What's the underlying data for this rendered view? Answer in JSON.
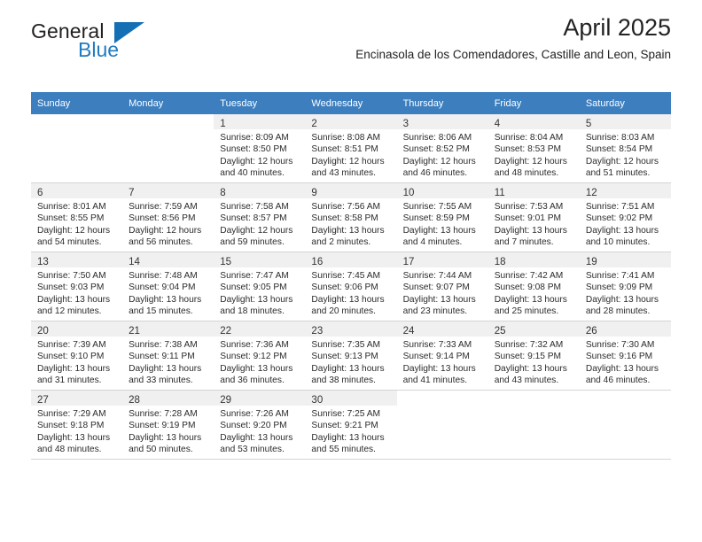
{
  "brand": {
    "name_part1": "General",
    "name_part2": "Blue",
    "triangle_icon": "logo-triangle-icon",
    "accent_color": "#156fb5"
  },
  "header": {
    "title": "April 2025",
    "subtitle": "Encinasola de los Comendadores, Castille and Leon, Spain"
  },
  "calendar": {
    "header_bg": "#3c7ebe",
    "daynum_bg": "#f0f0f0",
    "weekday_headers": [
      "Sunday",
      "Monday",
      "Tuesday",
      "Wednesday",
      "Thursday",
      "Friday",
      "Saturday"
    ],
    "weeks": [
      [
        {
          "day": "",
          "sunrise": "",
          "sunset": "",
          "daylight_line1": "",
          "daylight_line2": ""
        },
        {
          "day": "",
          "sunrise": "",
          "sunset": "",
          "daylight_line1": "",
          "daylight_line2": ""
        },
        {
          "day": "1",
          "sunrise": "Sunrise: 8:09 AM",
          "sunset": "Sunset: 8:50 PM",
          "daylight_line1": "Daylight: 12 hours",
          "daylight_line2": "and 40 minutes."
        },
        {
          "day": "2",
          "sunrise": "Sunrise: 8:08 AM",
          "sunset": "Sunset: 8:51 PM",
          "daylight_line1": "Daylight: 12 hours",
          "daylight_line2": "and 43 minutes."
        },
        {
          "day": "3",
          "sunrise": "Sunrise: 8:06 AM",
          "sunset": "Sunset: 8:52 PM",
          "daylight_line1": "Daylight: 12 hours",
          "daylight_line2": "and 46 minutes."
        },
        {
          "day": "4",
          "sunrise": "Sunrise: 8:04 AM",
          "sunset": "Sunset: 8:53 PM",
          "daylight_line1": "Daylight: 12 hours",
          "daylight_line2": "and 48 minutes."
        },
        {
          "day": "5",
          "sunrise": "Sunrise: 8:03 AM",
          "sunset": "Sunset: 8:54 PM",
          "daylight_line1": "Daylight: 12 hours",
          "daylight_line2": "and 51 minutes."
        }
      ],
      [
        {
          "day": "6",
          "sunrise": "Sunrise: 8:01 AM",
          "sunset": "Sunset: 8:55 PM",
          "daylight_line1": "Daylight: 12 hours",
          "daylight_line2": "and 54 minutes."
        },
        {
          "day": "7",
          "sunrise": "Sunrise: 7:59 AM",
          "sunset": "Sunset: 8:56 PM",
          "daylight_line1": "Daylight: 12 hours",
          "daylight_line2": "and 56 minutes."
        },
        {
          "day": "8",
          "sunrise": "Sunrise: 7:58 AM",
          "sunset": "Sunset: 8:57 PM",
          "daylight_line1": "Daylight: 12 hours",
          "daylight_line2": "and 59 minutes."
        },
        {
          "day": "9",
          "sunrise": "Sunrise: 7:56 AM",
          "sunset": "Sunset: 8:58 PM",
          "daylight_line1": "Daylight: 13 hours",
          "daylight_line2": "and 2 minutes."
        },
        {
          "day": "10",
          "sunrise": "Sunrise: 7:55 AM",
          "sunset": "Sunset: 8:59 PM",
          "daylight_line1": "Daylight: 13 hours",
          "daylight_line2": "and 4 minutes."
        },
        {
          "day": "11",
          "sunrise": "Sunrise: 7:53 AM",
          "sunset": "Sunset: 9:01 PM",
          "daylight_line1": "Daylight: 13 hours",
          "daylight_line2": "and 7 minutes."
        },
        {
          "day": "12",
          "sunrise": "Sunrise: 7:51 AM",
          "sunset": "Sunset: 9:02 PM",
          "daylight_line1": "Daylight: 13 hours",
          "daylight_line2": "and 10 minutes."
        }
      ],
      [
        {
          "day": "13",
          "sunrise": "Sunrise: 7:50 AM",
          "sunset": "Sunset: 9:03 PM",
          "daylight_line1": "Daylight: 13 hours",
          "daylight_line2": "and 12 minutes."
        },
        {
          "day": "14",
          "sunrise": "Sunrise: 7:48 AM",
          "sunset": "Sunset: 9:04 PM",
          "daylight_line1": "Daylight: 13 hours",
          "daylight_line2": "and 15 minutes."
        },
        {
          "day": "15",
          "sunrise": "Sunrise: 7:47 AM",
          "sunset": "Sunset: 9:05 PM",
          "daylight_line1": "Daylight: 13 hours",
          "daylight_line2": "and 18 minutes."
        },
        {
          "day": "16",
          "sunrise": "Sunrise: 7:45 AM",
          "sunset": "Sunset: 9:06 PM",
          "daylight_line1": "Daylight: 13 hours",
          "daylight_line2": "and 20 minutes."
        },
        {
          "day": "17",
          "sunrise": "Sunrise: 7:44 AM",
          "sunset": "Sunset: 9:07 PM",
          "daylight_line1": "Daylight: 13 hours",
          "daylight_line2": "and 23 minutes."
        },
        {
          "day": "18",
          "sunrise": "Sunrise: 7:42 AM",
          "sunset": "Sunset: 9:08 PM",
          "daylight_line1": "Daylight: 13 hours",
          "daylight_line2": "and 25 minutes."
        },
        {
          "day": "19",
          "sunrise": "Sunrise: 7:41 AM",
          "sunset": "Sunset: 9:09 PM",
          "daylight_line1": "Daylight: 13 hours",
          "daylight_line2": "and 28 minutes."
        }
      ],
      [
        {
          "day": "20",
          "sunrise": "Sunrise: 7:39 AM",
          "sunset": "Sunset: 9:10 PM",
          "daylight_line1": "Daylight: 13 hours",
          "daylight_line2": "and 31 minutes."
        },
        {
          "day": "21",
          "sunrise": "Sunrise: 7:38 AM",
          "sunset": "Sunset: 9:11 PM",
          "daylight_line1": "Daylight: 13 hours",
          "daylight_line2": "and 33 minutes."
        },
        {
          "day": "22",
          "sunrise": "Sunrise: 7:36 AM",
          "sunset": "Sunset: 9:12 PM",
          "daylight_line1": "Daylight: 13 hours",
          "daylight_line2": "and 36 minutes."
        },
        {
          "day": "23",
          "sunrise": "Sunrise: 7:35 AM",
          "sunset": "Sunset: 9:13 PM",
          "daylight_line1": "Daylight: 13 hours",
          "daylight_line2": "and 38 minutes."
        },
        {
          "day": "24",
          "sunrise": "Sunrise: 7:33 AM",
          "sunset": "Sunset: 9:14 PM",
          "daylight_line1": "Daylight: 13 hours",
          "daylight_line2": "and 41 minutes."
        },
        {
          "day": "25",
          "sunrise": "Sunrise: 7:32 AM",
          "sunset": "Sunset: 9:15 PM",
          "daylight_line1": "Daylight: 13 hours",
          "daylight_line2": "and 43 minutes."
        },
        {
          "day": "26",
          "sunrise": "Sunrise: 7:30 AM",
          "sunset": "Sunset: 9:16 PM",
          "daylight_line1": "Daylight: 13 hours",
          "daylight_line2": "and 46 minutes."
        }
      ],
      [
        {
          "day": "27",
          "sunrise": "Sunrise: 7:29 AM",
          "sunset": "Sunset: 9:18 PM",
          "daylight_line1": "Daylight: 13 hours",
          "daylight_line2": "and 48 minutes."
        },
        {
          "day": "28",
          "sunrise": "Sunrise: 7:28 AM",
          "sunset": "Sunset: 9:19 PM",
          "daylight_line1": "Daylight: 13 hours",
          "daylight_line2": "and 50 minutes."
        },
        {
          "day": "29",
          "sunrise": "Sunrise: 7:26 AM",
          "sunset": "Sunset: 9:20 PM",
          "daylight_line1": "Daylight: 13 hours",
          "daylight_line2": "and 53 minutes."
        },
        {
          "day": "30",
          "sunrise": "Sunrise: 7:25 AM",
          "sunset": "Sunset: 9:21 PM",
          "daylight_line1": "Daylight: 13 hours",
          "daylight_line2": "and 55 minutes."
        },
        {
          "day": "",
          "sunrise": "",
          "sunset": "",
          "daylight_line1": "",
          "daylight_line2": ""
        },
        {
          "day": "",
          "sunrise": "",
          "sunset": "",
          "daylight_line1": "",
          "daylight_line2": ""
        },
        {
          "day": "",
          "sunrise": "",
          "sunset": "",
          "daylight_line1": "",
          "daylight_line2": ""
        }
      ]
    ]
  }
}
